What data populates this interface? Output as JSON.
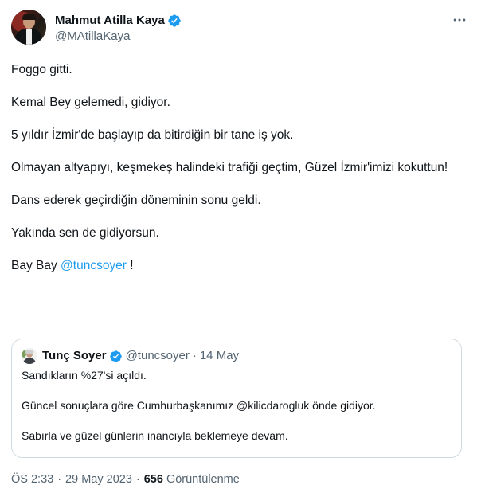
{
  "author": {
    "name": "Mahmut Atilla Kaya",
    "handle": "@MAtillaKaya"
  },
  "icons": {
    "avatar": "profile-photo",
    "verified": "verified-badge-icon",
    "more": "more-options-icon"
  },
  "colors": {
    "accent": "#1d9bf0",
    "text": "#0f1419",
    "secondary": "#536471",
    "border": "#cfd9de"
  },
  "tweet": {
    "p1": "Foggo gitti.",
    "p2": "Kemal Bey gelemedi, gidiyor.",
    "p3": "5 yıldır İzmir'de başlayıp da bitirdiğin bir tane iş yok.",
    "p4": "Olmayan altyapıyı, keşmekeş halindeki trafiği geçtim, Güzel İzmir'imizi kokuttun!",
    "p5": "Dans ederek geçirdiğin döneminin sonu geldi.",
    "p6": "Yakında sen de gidiyorsun.",
    "p7_prefix": "Bay Bay ",
    "p7_mention": "@tuncsoyer",
    "p7_suffix": " !"
  },
  "quote": {
    "name": "Tunç Soyer",
    "handle": "@tuncsoyer",
    "separator": "·",
    "date": "14 May",
    "p1": "Sandıkların %27'si açıldı.",
    "p2": "Güncel sonuçlara göre Cumhurbaşkanımız @kilicdarogluk önde gidiyor.",
    "p3": "Sabırla ve güzel günlerin inancıyla beklemeye devam."
  },
  "meta": {
    "time": "ÖS 2:33",
    "sep1": "·",
    "date": "29 May 2023",
    "sep2": "·",
    "views_count": "656",
    "views_label": "Görüntülenme"
  }
}
